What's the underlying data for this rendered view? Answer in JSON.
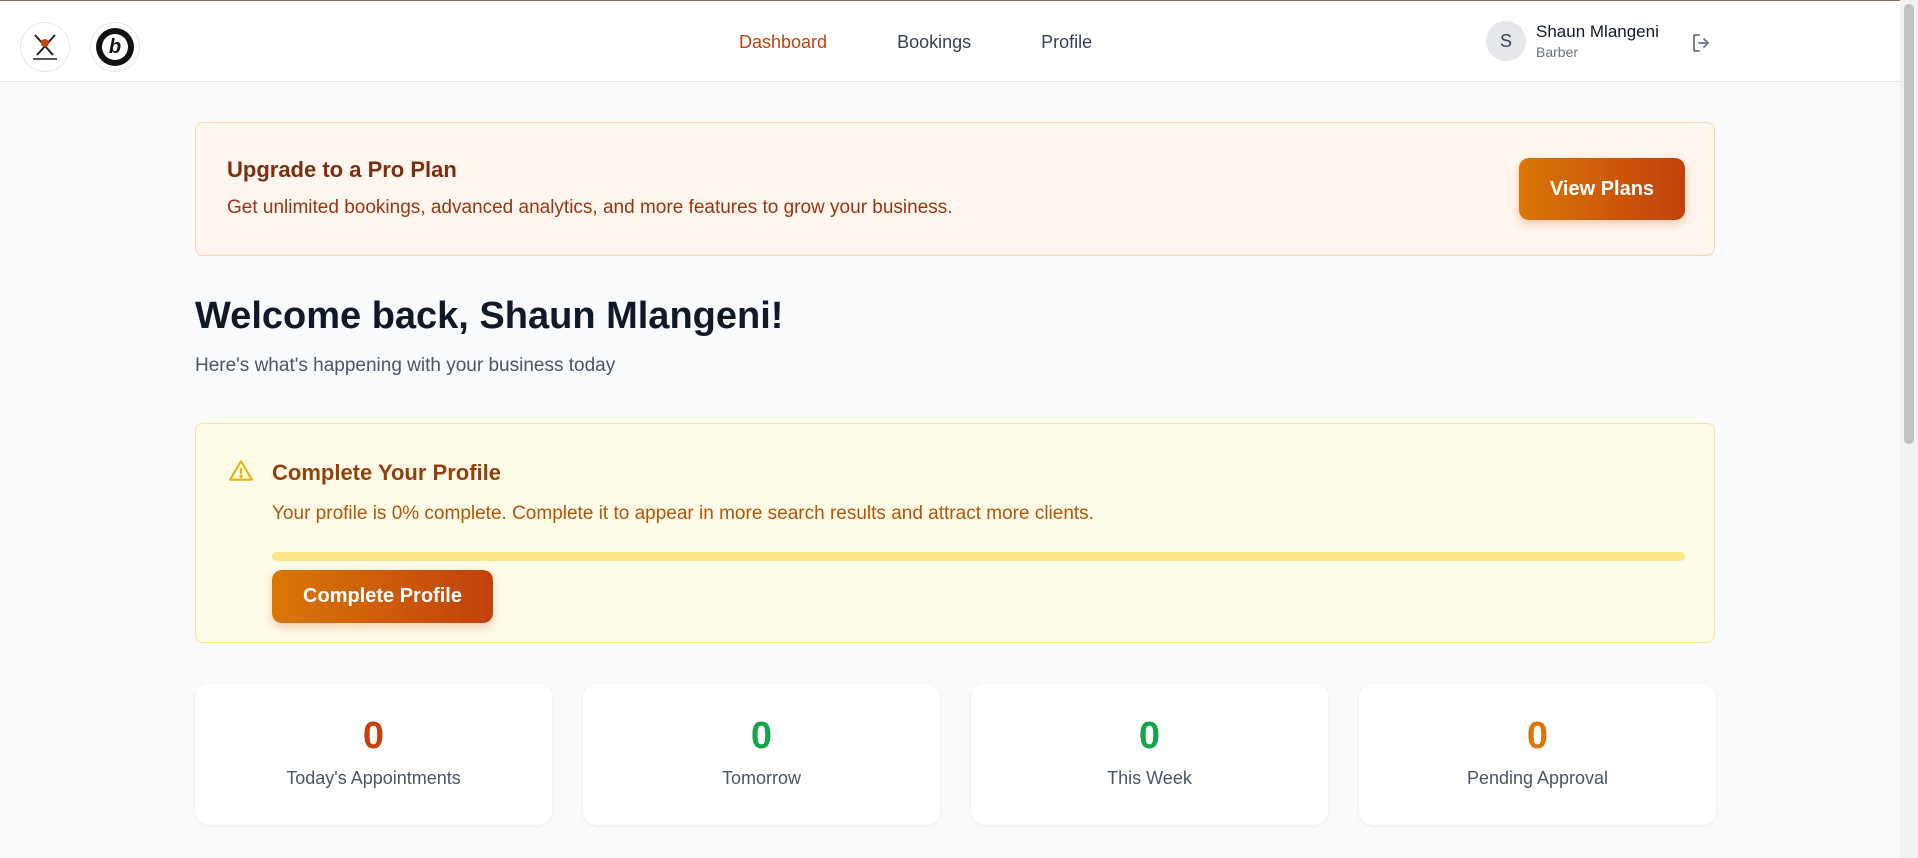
{
  "header": {
    "nav": [
      {
        "label": "Dashboard",
        "active": true
      },
      {
        "label": "Bookings",
        "active": false
      },
      {
        "label": "Profile",
        "active": false
      }
    ],
    "user": {
      "initial": "S",
      "name": "Shaun Mlangeni",
      "role": "Barber"
    },
    "logo2_letter": "b"
  },
  "upgrade": {
    "title": "Upgrade to a Pro Plan",
    "description": "Get unlimited bookings, advanced analytics, and more features to grow your business.",
    "button": "View Plans"
  },
  "welcome": {
    "title": "Welcome back, Shaun Mlangeni!",
    "subtitle": "Here's what's happening with your business today"
  },
  "complete_profile": {
    "title": "Complete Your Profile",
    "description": "Your profile is 0% complete. Complete it to appear in more search results and attract more clients.",
    "progress_percent": 0,
    "button": "Complete Profile"
  },
  "stats": [
    {
      "value": "0",
      "label": "Today's Appointments",
      "color": "#c2410c"
    },
    {
      "value": "0",
      "label": "Tomorrow",
      "color": "#16a34a"
    },
    {
      "value": "0",
      "label": "This Week",
      "color": "#16a34a"
    },
    {
      "value": "0",
      "label": "Pending Approval",
      "color": "#d97706"
    }
  ],
  "colors": {
    "accent": "#c2410c",
    "accent_light": "#d97706",
    "warning_bg": "#fefce8"
  }
}
